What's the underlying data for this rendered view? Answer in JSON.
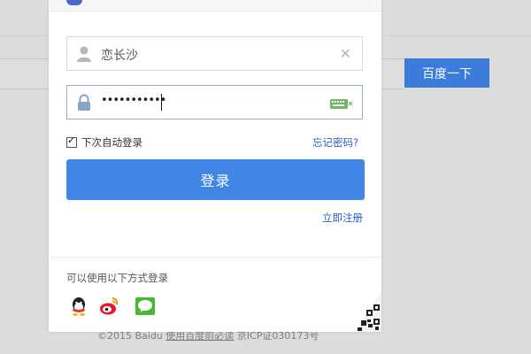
{
  "background": {
    "search_button_label": "百度一下",
    "footer_text_prefix": "©2015 Baidu ",
    "footer_link": "使用百度前必读",
    "footer_text_suffix": " 京ICP证030173号"
  },
  "login": {
    "username_value": "恋长沙",
    "password_value": "•••••••••••",
    "remember_label": "下次自动登录",
    "remember_checked": true,
    "forgot_label": "忘记密码?",
    "login_button_label": "登录",
    "register_label": "立即注册",
    "other_methods_label": "可以使用以下方式登录"
  },
  "colors": {
    "accent": "#3f86e6",
    "link": "#2d5fc3",
    "background": "#dcdcdc"
  },
  "icons": [
    "user-icon",
    "clear-icon",
    "lock-icon",
    "keyboard-icon",
    "qq-icon",
    "weibo-icon",
    "wechat-icon",
    "qrcode-icon"
  ]
}
